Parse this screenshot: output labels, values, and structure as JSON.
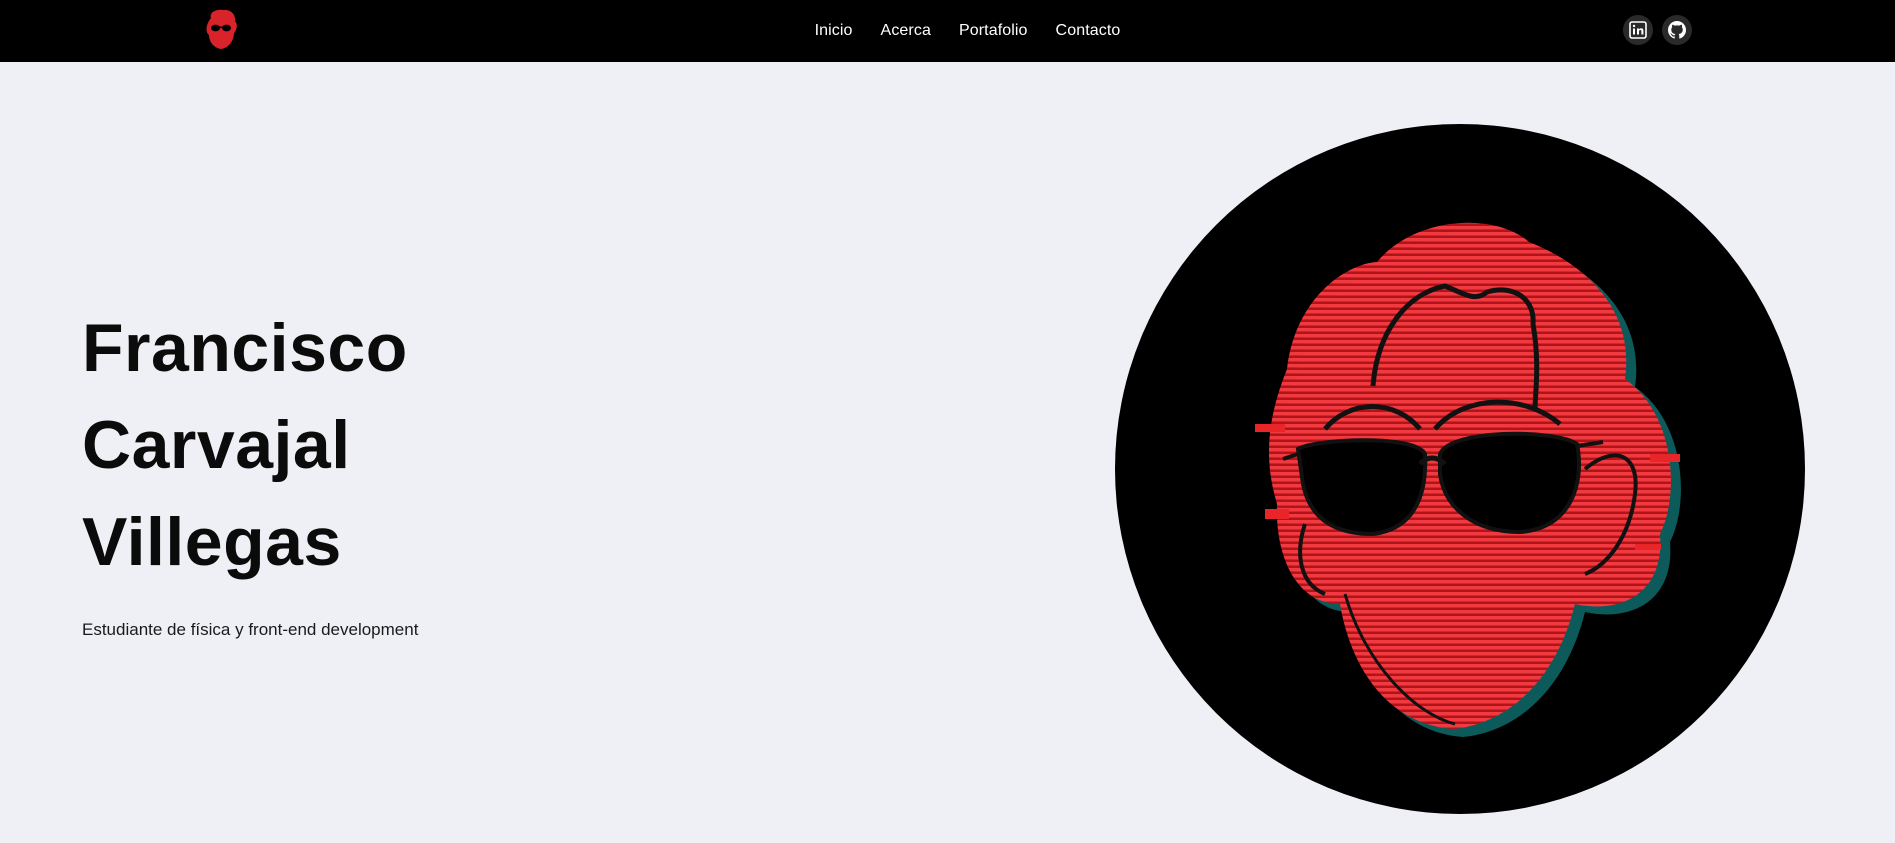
{
  "header": {
    "logo_icon": "red-face-sunglasses-logo-icon",
    "nav": [
      {
        "label": "Inicio"
      },
      {
        "label": "Acerca"
      },
      {
        "label": "Portafolio"
      },
      {
        "label": "Contacto"
      }
    ],
    "social": [
      {
        "icon": "linkedin-icon"
      },
      {
        "icon": "github-icon"
      }
    ]
  },
  "hero": {
    "name_lines": [
      "Francisco",
      "Carvajal",
      "Villegas"
    ],
    "subtitle": "Estudiante de física y front-end development",
    "portrait_icon": "red-face-sunglasses-portrait"
  },
  "colors": {
    "background": "#eff0f5",
    "header": "#000000",
    "accent_red": "#e8262a",
    "text": "#0b0b0b"
  }
}
